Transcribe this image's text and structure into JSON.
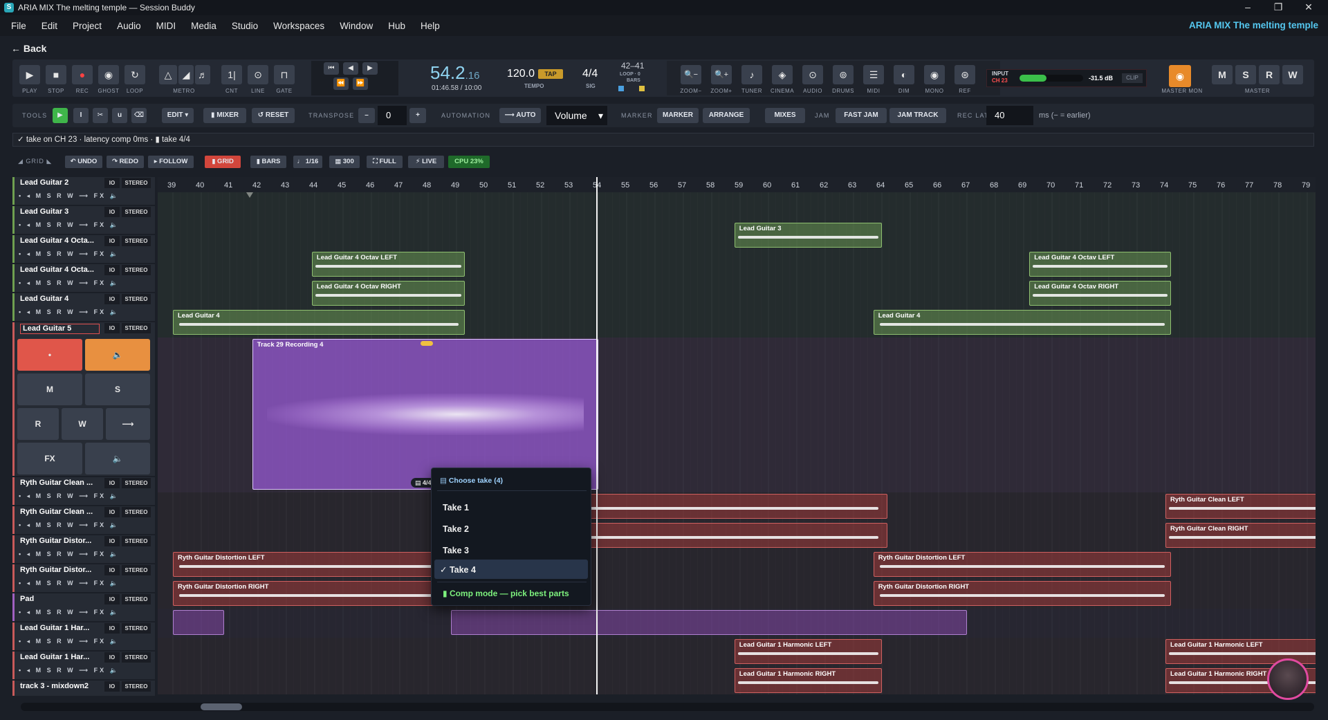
{
  "window": {
    "title": "ARIA MIX The melting temple — Session Buddy",
    "logo": "S",
    "minimize": "–",
    "restore": "❐",
    "close": "✕"
  },
  "menu": [
    "File",
    "Edit",
    "Project",
    "Audio",
    "MIDI",
    "Media",
    "Studio",
    "Workspaces",
    "Window",
    "Hub",
    "Help"
  ],
  "brand": "ARIA MIX The melting temple",
  "back": "← Back",
  "transport": {
    "buttons": [
      {
        "icon": "▶",
        "label": "PLAY"
      },
      {
        "icon": "■",
        "label": "STOP"
      },
      {
        "icon": "●",
        "label": "REC"
      },
      {
        "icon": "◉",
        "label": "GHOST"
      },
      {
        "icon": "↻",
        "label": "LOOP"
      },
      {
        "icon": "△",
        "label": "METRO"
      },
      {
        "icon": "◢",
        "label": ""
      },
      {
        "icon": "♬",
        "label": ""
      },
      {
        "icon": "1|",
        "label": "CNT"
      },
      {
        "icon": "⊙",
        "label": "LINE"
      },
      {
        "icon": "⊓",
        "label": "GATE"
      }
    ],
    "nav": [
      "⏮",
      "◀",
      "▶",
      "⏪",
      "⏩"
    ],
    "counter": "54.2",
    "counter_sub": ".16",
    "time": "01:46.58 / 10:00",
    "tempo": "120.0",
    "tempo_label": "TEMPO",
    "tap": "TAP",
    "sig": "4/4",
    "sig_label": "SIG",
    "loop": "42–41",
    "loop_label": "LOOP · 0",
    "bars_label": "BARS",
    "tools": [
      {
        "icon": "🔍−",
        "label": "ZOOM−"
      },
      {
        "icon": "🔍+",
        "label": "ZOOM+"
      },
      {
        "icon": "♪",
        "label": "TUNER"
      },
      {
        "icon": "◈",
        "label": "CINEMA"
      },
      {
        "icon": "⊙",
        "label": "AUDIO"
      },
      {
        "icon": "⊚",
        "label": "DRUMS"
      },
      {
        "icon": "☰",
        "label": "MIDI"
      },
      {
        "icon": "◐",
        "label": "DIM"
      },
      {
        "icon": "◉",
        "label": "MONO"
      },
      {
        "icon": "⊛",
        "label": "REF"
      }
    ],
    "input_label": "INPUT",
    "input_ch": "CH 23",
    "input_db": "-31.5 dB",
    "clip": "CLIP",
    "master_mon": "MASTER MON",
    "master_mon_icon": "◉",
    "master": [
      "M",
      "S",
      "R",
      "W"
    ],
    "master_label": "MASTER"
  },
  "toolsrow": {
    "tools_label": "TOOLS",
    "tool_icons": [
      "▶",
      "I",
      "✂",
      "u",
      "⌫"
    ],
    "edit": "EDIT ▾",
    "mixer": "▮ MIXER",
    "reset": "↺ RESET",
    "transpose_label": "TRANSPOSE",
    "minus": "–",
    "transpose": "0",
    "plus": "+",
    "automation_label": "AUTOMATION",
    "auto": "⟶ AUTO",
    "volume": "Volume",
    "marker_label": "MARKER",
    "marker": "MARKER",
    "arrange": "ARRANGE",
    "mixes": "MIXES",
    "jam_label": "JAM",
    "fastjam": "FAST JAM",
    "jamtrack": "JAM TRACK",
    "reclat_label": "REC LAT",
    "reclat": "40",
    "reclat_hint": "ms (− = earlier)"
  },
  "status": "✓ take on CH 23 · latency comp 0ms · ▮ take 4/4",
  "gridbar": {
    "grid_label": "◢ GRID ◣",
    "undo": "↶ UNDO",
    "redo": "↷ REDO",
    "follow": "▸ FOLLOW",
    "grid": "▮ GRID",
    "bars": "▮ BARS",
    "snap": "♩ 1/16",
    "zoom": "▦ 300",
    "full": "⛶ FULL",
    "live": "⚡ LIVE",
    "cpu": "CPU 23%"
  },
  "ruler": [
    "39",
    "40",
    "41",
    "42",
    "43",
    "44",
    "45",
    "46",
    "47",
    "48",
    "49",
    "50",
    "51",
    "52",
    "53",
    "54",
    "55",
    "56",
    "57",
    "58",
    "59",
    "60",
    "61",
    "62",
    "63",
    "64",
    "65",
    "66",
    "67",
    "68",
    "69",
    "70",
    "71",
    "72",
    "73",
    "74",
    "75",
    "76",
    "77",
    "78",
    "79"
  ],
  "tracks": [
    {
      "name": "Lead Guitar 2",
      "color": "#6fa050"
    },
    {
      "name": "Lead Guitar 3",
      "color": "#6fa050"
    },
    {
      "name": "Lead Guitar 4 Octa...",
      "color": "#6fa050"
    },
    {
      "name": "Lead Guitar 4 Octa...",
      "color": "#6fa050"
    },
    {
      "name": "Lead Guitar 4",
      "color": "#6fa050"
    },
    {
      "name": "Lead Guitar 5",
      "color": "#c85a5a"
    },
    {
      "name": "Ryth Guitar Clean ...",
      "color": "#c85a5a"
    },
    {
      "name": "Ryth Guitar Clean ...",
      "color": "#c85a5a"
    },
    {
      "name": "Ryth Guitar Distor...",
      "color": "#c85a5a"
    },
    {
      "name": "Ryth Guitar Distor...",
      "color": "#c85a5a"
    },
    {
      "name": "Pad",
      "color": "#a060c0"
    },
    {
      "name": "Lead Guitar 1 Har...",
      "color": "#c85a5a"
    },
    {
      "name": "Lead Guitar 1 Har...",
      "color": "#c85a5a"
    },
    {
      "name": "track 3 - mixdown2",
      "color": "#c85a5a"
    }
  ],
  "track_io": "IO",
  "track_stereo": "STEREO",
  "track_strip": "• ◂ M S R W ⟶ FX 🔈",
  "selected_track_buttons": {
    "rec": "•",
    "mon": "🔈",
    "m": "M",
    "s": "S",
    "r": "R",
    "w": "W",
    "arrow": "⟶",
    "fx": "FX",
    "vol": "🔈"
  },
  "clips": {
    "lg3": "Lead Guitar 3",
    "oct_left": "Lead Guitar 4 Octav LEFT",
    "oct_right": "Lead Guitar 4 Octav RIGHT",
    "lg4": "Lead Guitar 4",
    "rec": "Track 29 Recording 4",
    "rec_take": "▤ 4/4",
    "clean_left": "Ryth Guitar Clean LEFT",
    "clean_right": "Ryth Guitar Clean RIGHT",
    "dist_left": "Ryth Guitar Distortion LEFT",
    "dist_right": "Ryth Guitar Distortion RIGHT",
    "harm_left": "Lead Guitar 1 Harmonic LEFT",
    "harm_right": "Lead Guitar 1 Harmonic RIGHT"
  },
  "takemenu": {
    "header": "▤ Choose take (4)",
    "takes": [
      "Take 1",
      "Take 2",
      "Take 3",
      "✓ Take 4"
    ],
    "comp": "▮ Comp mode — pick best parts"
  }
}
